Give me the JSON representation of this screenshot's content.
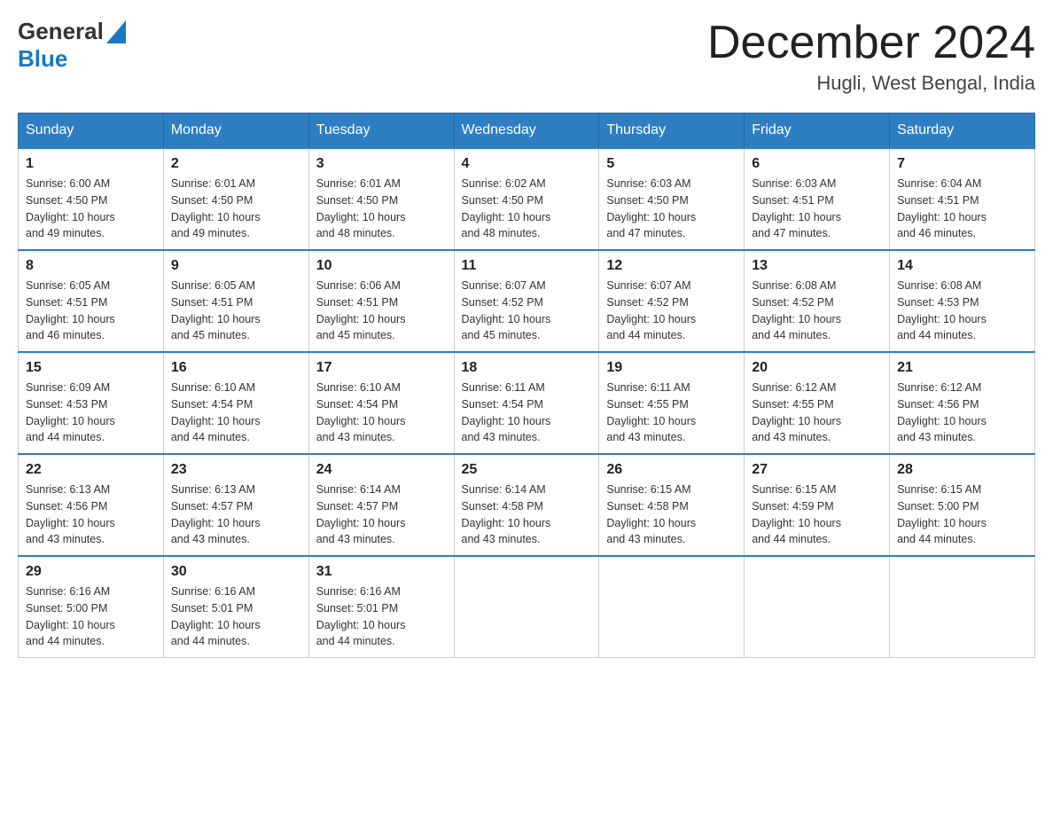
{
  "header": {
    "logo_general": "General",
    "logo_blue": "Blue",
    "month_year": "December 2024",
    "location": "Hugli, West Bengal, India"
  },
  "days_of_week": [
    "Sunday",
    "Monday",
    "Tuesday",
    "Wednesday",
    "Thursday",
    "Friday",
    "Saturday"
  ],
  "weeks": [
    [
      {
        "day": "1",
        "sunrise": "6:00 AM",
        "sunset": "4:50 PM",
        "daylight": "10 hours and 49 minutes."
      },
      {
        "day": "2",
        "sunrise": "6:01 AM",
        "sunset": "4:50 PM",
        "daylight": "10 hours and 49 minutes."
      },
      {
        "day": "3",
        "sunrise": "6:01 AM",
        "sunset": "4:50 PM",
        "daylight": "10 hours and 48 minutes."
      },
      {
        "day": "4",
        "sunrise": "6:02 AM",
        "sunset": "4:50 PM",
        "daylight": "10 hours and 48 minutes."
      },
      {
        "day": "5",
        "sunrise": "6:03 AM",
        "sunset": "4:50 PM",
        "daylight": "10 hours and 47 minutes."
      },
      {
        "day": "6",
        "sunrise": "6:03 AM",
        "sunset": "4:51 PM",
        "daylight": "10 hours and 47 minutes."
      },
      {
        "day": "7",
        "sunrise": "6:04 AM",
        "sunset": "4:51 PM",
        "daylight": "10 hours and 46 minutes."
      }
    ],
    [
      {
        "day": "8",
        "sunrise": "6:05 AM",
        "sunset": "4:51 PM",
        "daylight": "10 hours and 46 minutes."
      },
      {
        "day": "9",
        "sunrise": "6:05 AM",
        "sunset": "4:51 PM",
        "daylight": "10 hours and 45 minutes."
      },
      {
        "day": "10",
        "sunrise": "6:06 AM",
        "sunset": "4:51 PM",
        "daylight": "10 hours and 45 minutes."
      },
      {
        "day": "11",
        "sunrise": "6:07 AM",
        "sunset": "4:52 PM",
        "daylight": "10 hours and 45 minutes."
      },
      {
        "day": "12",
        "sunrise": "6:07 AM",
        "sunset": "4:52 PM",
        "daylight": "10 hours and 44 minutes."
      },
      {
        "day": "13",
        "sunrise": "6:08 AM",
        "sunset": "4:52 PM",
        "daylight": "10 hours and 44 minutes."
      },
      {
        "day": "14",
        "sunrise": "6:08 AM",
        "sunset": "4:53 PM",
        "daylight": "10 hours and 44 minutes."
      }
    ],
    [
      {
        "day": "15",
        "sunrise": "6:09 AM",
        "sunset": "4:53 PM",
        "daylight": "10 hours and 44 minutes."
      },
      {
        "day": "16",
        "sunrise": "6:10 AM",
        "sunset": "4:54 PM",
        "daylight": "10 hours and 44 minutes."
      },
      {
        "day": "17",
        "sunrise": "6:10 AM",
        "sunset": "4:54 PM",
        "daylight": "10 hours and 43 minutes."
      },
      {
        "day": "18",
        "sunrise": "6:11 AM",
        "sunset": "4:54 PM",
        "daylight": "10 hours and 43 minutes."
      },
      {
        "day": "19",
        "sunrise": "6:11 AM",
        "sunset": "4:55 PM",
        "daylight": "10 hours and 43 minutes."
      },
      {
        "day": "20",
        "sunrise": "6:12 AM",
        "sunset": "4:55 PM",
        "daylight": "10 hours and 43 minutes."
      },
      {
        "day": "21",
        "sunrise": "6:12 AM",
        "sunset": "4:56 PM",
        "daylight": "10 hours and 43 minutes."
      }
    ],
    [
      {
        "day": "22",
        "sunrise": "6:13 AM",
        "sunset": "4:56 PM",
        "daylight": "10 hours and 43 minutes."
      },
      {
        "day": "23",
        "sunrise": "6:13 AM",
        "sunset": "4:57 PM",
        "daylight": "10 hours and 43 minutes."
      },
      {
        "day": "24",
        "sunrise": "6:14 AM",
        "sunset": "4:57 PM",
        "daylight": "10 hours and 43 minutes."
      },
      {
        "day": "25",
        "sunrise": "6:14 AM",
        "sunset": "4:58 PM",
        "daylight": "10 hours and 43 minutes."
      },
      {
        "day": "26",
        "sunrise": "6:15 AM",
        "sunset": "4:58 PM",
        "daylight": "10 hours and 43 minutes."
      },
      {
        "day": "27",
        "sunrise": "6:15 AM",
        "sunset": "4:59 PM",
        "daylight": "10 hours and 44 minutes."
      },
      {
        "day": "28",
        "sunrise": "6:15 AM",
        "sunset": "5:00 PM",
        "daylight": "10 hours and 44 minutes."
      }
    ],
    [
      {
        "day": "29",
        "sunrise": "6:16 AM",
        "sunset": "5:00 PM",
        "daylight": "10 hours and 44 minutes."
      },
      {
        "day": "30",
        "sunrise": "6:16 AM",
        "sunset": "5:01 PM",
        "daylight": "10 hours and 44 minutes."
      },
      {
        "day": "31",
        "sunrise": "6:16 AM",
        "sunset": "5:01 PM",
        "daylight": "10 hours and 44 minutes."
      },
      null,
      null,
      null,
      null
    ]
  ],
  "labels": {
    "sunrise": "Sunrise:",
    "sunset": "Sunset:",
    "daylight": "Daylight:"
  }
}
